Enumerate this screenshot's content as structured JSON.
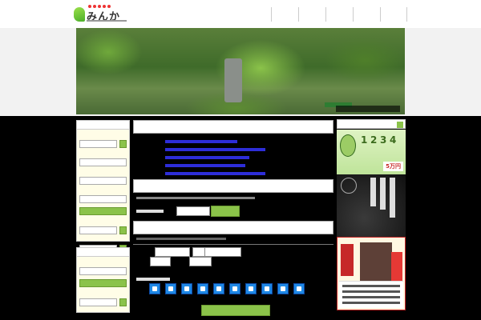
{
  "header": {
    "logo_text": "みんかつ",
    "nav": [
      "",
      "",
      "",
      "",
      ""
    ]
  },
  "hero": {
    "caption": ""
  },
  "sidebar": {
    "box1": {
      "title": "",
      "labels": [
        "",
        "",
        "",
        "",
        ""
      ],
      "values": [
        "",
        "",
        "",
        ""
      ],
      "submit": "",
      "labels_2": [
        "",
        ""
      ],
      "more": ""
    },
    "box2": {
      "title": "",
      "labels": [
        "",
        ""
      ],
      "values": [
        "",
        ""
      ],
      "submit": "",
      "more": ""
    }
  },
  "news": {
    "title": "",
    "dates": [
      "",
      "",
      "",
      "",
      ""
    ]
  },
  "category": {
    "title": "",
    "select_value": "",
    "button": ""
  },
  "detail": {
    "title": "",
    "fields": [
      "",
      "",
      "",
      ""
    ],
    "button": ""
  },
  "banner": {
    "marks": [
      "1",
      "2",
      "3",
      "4"
    ],
    "price": "5万円"
  },
  "colors": {
    "accent": "#8bc34a",
    "link": "#2d2dd8",
    "background": "#000000",
    "panel": "#fffde7"
  },
  "icons": [
    "leaf-logo-icon",
    "food-icon",
    "tent-icon",
    "toilet-icon",
    "bath-icon",
    "bench-icon",
    "parking-icon",
    "shower-icon",
    "sink-icon",
    "car-icon",
    "shop-icon",
    "fire-icon"
  ]
}
